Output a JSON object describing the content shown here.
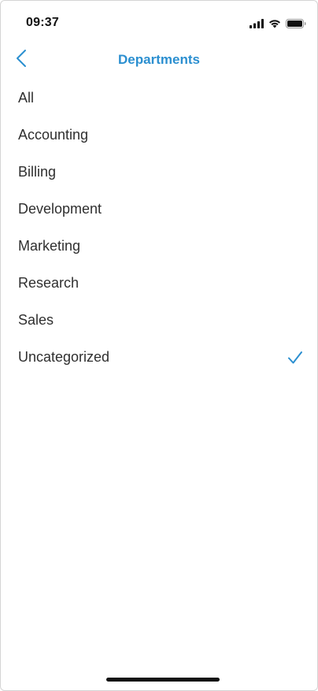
{
  "status_bar": {
    "time": "09:37",
    "icons": [
      "cellular-signal-icon",
      "wifi-icon",
      "battery-icon"
    ]
  },
  "nav": {
    "title": "Departments",
    "back_icon": "chevron-left-icon"
  },
  "departments": {
    "items": [
      {
        "label": "All",
        "selected": false
      },
      {
        "label": "Accounting",
        "selected": false
      },
      {
        "label": "Billing",
        "selected": false
      },
      {
        "label": "Development",
        "selected": false
      },
      {
        "label": "Marketing",
        "selected": false
      },
      {
        "label": "Research",
        "selected": false
      },
      {
        "label": "Sales",
        "selected": false
      },
      {
        "label": "Uncategorized",
        "selected": true
      }
    ],
    "selected_icon": "checkmark-icon"
  },
  "colors": {
    "accent": "#2b8fd0",
    "text": "#2f2f2f",
    "background": "#ffffff"
  }
}
